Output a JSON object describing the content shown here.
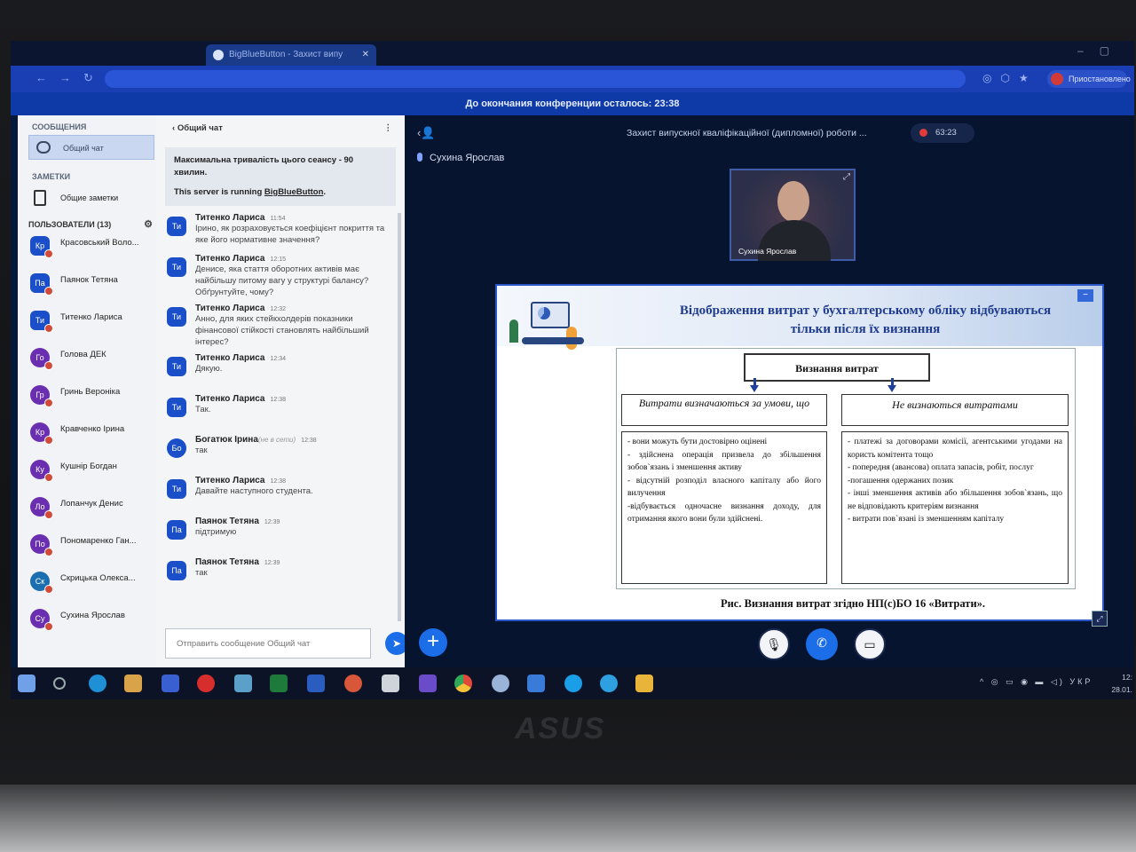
{
  "browser": {
    "tab_title": "BigBlueButton - Захист випу",
    "profile_label": "Приостановлено"
  },
  "banner": "До окончания конференции осталось: 23:38",
  "sidebar": {
    "messages_header": "СООБЩЕНИЯ",
    "public_chat": "Общий чат",
    "notes_header": "ЗАМЕТКИ",
    "shared_notes": "Общие заметки",
    "users_header": "ПОЛЬЗОВАТЕЛИ (13)",
    "users": [
      {
        "initials": "Кр",
        "name": "Красовський Воло...",
        "color": "#1b4fc9"
      },
      {
        "initials": "Па",
        "name": "Паянок Тетяна",
        "color": "#1b4fc9"
      },
      {
        "initials": "Ти",
        "name": "Титенко Лариса",
        "color": "#1b4fc9"
      },
      {
        "initials": "Го",
        "name": "Голова ДЕК",
        "color": "#6a2fb0"
      },
      {
        "initials": "Гр",
        "name": "Гринь Вероніка",
        "color": "#6a2fb0"
      },
      {
        "initials": "Кр",
        "name": "Кравченко Ірина",
        "color": "#6a2fb0"
      },
      {
        "initials": "Ку",
        "name": "Кушнір Богдан",
        "color": "#6a2fb0"
      },
      {
        "initials": "Ло",
        "name": "Лопанчук Денис",
        "color": "#6a2fb0"
      },
      {
        "initials": "По",
        "name": "Пономаренко Ган...",
        "color": "#6a2fb0"
      },
      {
        "initials": "Ск",
        "name": "Скрицька Олекса...",
        "color": "#1b6fb0"
      },
      {
        "initials": "Су",
        "name": "Сухина Ярослав",
        "color": "#6a2fb0"
      }
    ]
  },
  "chat": {
    "title": "Общий чат",
    "welcome_1": "Максимальна тривалість цього сеансу - 90 хвилин.",
    "welcome_2_prefix": "This server is running ",
    "welcome_2_link": "BigBlueButton",
    "welcome_2_suffix": ".",
    "messages": [
      {
        "initials": "Ти",
        "name": "Титенко Лариса",
        "time": "11:54",
        "offline": "",
        "text": "Ірино, як розраховується коефіцієнт покриття та яке його нормативне значення?"
      },
      {
        "initials": "Ти",
        "name": "Титенко Лариса",
        "time": "12:15",
        "offline": "",
        "text": "Денисе, яка стаття оборотних активів має найбільшу питому вагу у структурі балансу? Обґрунтуйте, чому?"
      },
      {
        "initials": "Ти",
        "name": "Титенко Лариса",
        "time": "12:32",
        "offline": "",
        "text": "Анно, для яких стейкхолдерів показники фінансової стійкості становлять найбільший інтерес?"
      },
      {
        "initials": "Ти",
        "name": "Титенко Лариса",
        "time": "12:34",
        "offline": "",
        "text": "Дякую."
      },
      {
        "initials": "Ти",
        "name": "Титенко Лариса",
        "time": "12:38",
        "offline": "",
        "text": "Так."
      },
      {
        "initials": "Бо",
        "name": "Богатюк Ірина",
        "time": "12:38",
        "offline": "(не в сети)",
        "text": "так"
      },
      {
        "initials": "Ти",
        "name": "Титенко Лариса",
        "time": "12:38",
        "offline": "",
        "text": "Давайте наступного студента."
      },
      {
        "initials": "Па",
        "name": "Паянок Тетяна",
        "time": "12:39",
        "offline": "",
        "text": "підтримую"
      },
      {
        "initials": "Па",
        "name": "Паянок Тетяна",
        "time": "12:39",
        "offline": "",
        "text": "так"
      }
    ],
    "input_placeholder": "Отправить сообщение Общий чат"
  },
  "main": {
    "meeting_title": "Захист випускної кваліфікаційної (дипломної) роботи ...",
    "recording_time": "63:23",
    "talking_user": "Сухина Ярослав",
    "webcam_label": "Сухина Ярослав"
  },
  "slide": {
    "title": "Відображення витрат у бухгалтерському обліку відбуваються тільки після їх визнання",
    "main_box": "Визнання витрат",
    "left_header": "Витрати визначаються за умови, що",
    "right_header": "Не визнаються витратами",
    "left_items": [
      "- вони можуть бути достовірно оцінені",
      "- здійснена операція призвела до збільшення зобов`язань і зменшення активу",
      "- відсутній розподіл власного капіталу або його вилучення",
      "-відбувається одночасне визнання доходу, для отримання якого вони були здійснені."
    ],
    "right_items": [
      "- платежі за договорами комісії, агентськими угодами на користь комітента тощо",
      "- попередня (авансова) оплата запасів, робіт, послуг",
      "-погашення одержаних позик",
      "- інші зменшення активів або збільшення зобов`язань, що не відповідають критеріям визнання",
      "- витрати пов`язані із зменшенням капіталу"
    ],
    "caption": "Рис. Визнання витрат згідно НП(с)БО 16 «Витрати»."
  },
  "taskbar": {
    "lang": "УКР",
    "time": "12:",
    "date": "28.01."
  },
  "laptop_brand": "ASUS"
}
